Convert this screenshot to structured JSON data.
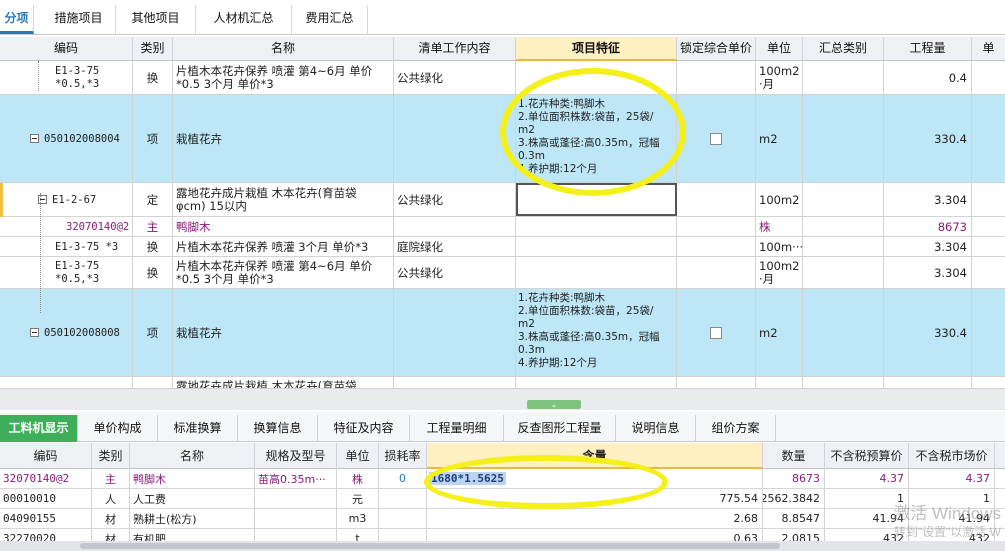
{
  "top_tabs": [
    "分项",
    "措施项目",
    "其他项目",
    "人材机汇总",
    "费用汇总"
  ],
  "grid": {
    "headers": [
      "编码",
      "类别",
      "名称",
      "清单工作内容",
      "项目特征",
      "锁定综合单价",
      "单位",
      "汇总类别",
      "工程量",
      "单"
    ],
    "rows": [
      {
        "code": "E1-3-75\n*0.5,*3",
        "type": "换",
        "name": "片植木本花卉保养 喷灌  第4~6月 单价\n*0.5  3个月 单价*3",
        "work": "公共绿化",
        "feature": "",
        "unit": "100m2\n·月",
        "qty": "0.4"
      },
      {
        "code": "050102008004",
        "type": "项",
        "name": "栽植花卉",
        "work": "",
        "feature": "1.花卉种类:鸭脚木\n2.单位面积株数:袋苗，25袋/\nm2\n3.株高或蓬径:高0.35m，冠幅\n0.3m\n4.养护期:12个月",
        "unit": "m2",
        "qty": "330.4"
      },
      {
        "code": "E1-2-67",
        "type": "定",
        "name": "露地花卉成片栽植 木本花卉(育苗袋\nφcm) 15以内",
        "work": "公共绿化",
        "feature": "",
        "unit": "100m2",
        "qty": "3.304"
      },
      {
        "code": "32070140@2",
        "type": "主",
        "name": "鸭脚木",
        "work": "",
        "feature": "",
        "unit": "株",
        "qty": "8673"
      },
      {
        "code": "E1-3-75 *3",
        "type": "换",
        "name": "片植木本花卉保养 喷灌  3个月 单价*3",
        "work": "庭院绿化",
        "feature": "",
        "unit": "100m···",
        "qty": "3.304"
      },
      {
        "code": "E1-3-75\n*0.5,*3",
        "type": "换",
        "name": "片植木本花卉保养 喷灌  第4~6月 单价\n*0.5  3个月 单价*3",
        "work": "公共绿化",
        "feature": "",
        "unit": "100m2\n·月",
        "qty": "3.304"
      },
      {
        "code": "050102008008",
        "type": "项",
        "name": "栽植花卉",
        "work": "",
        "feature": "1.花卉种类:鸭脚木\n2.单位面积株数:袋苗，25袋/\nm2\n3.株高或蓬径:高0.35m，冠幅\n0.3m\n4.养护期:12个月",
        "unit": "m2",
        "qty": "330.4"
      },
      {
        "code": "",
        "type": "",
        "name": "露地花卉成片栽植 木本花卉(育苗袋",
        "work": "",
        "feature": "",
        "unit": "",
        "qty": ""
      }
    ]
  },
  "bottom_tabs": [
    "工料机显示",
    "单价构成",
    "标准换算",
    "换算信息",
    "特征及内容",
    "工程量明细",
    "反查图形工程量",
    "说明信息",
    "组价方案"
  ],
  "bottom_grid": {
    "headers": [
      "编码",
      "类别",
      "名称",
      "规格及型号",
      "单位",
      "损耗率",
      "含量",
      "数量",
      "不含税预算价",
      "不含税市场价"
    ],
    "rows": [
      {
        "code": "32070140@2",
        "type": "主",
        "name": "鸭脚木",
        "spec": "苗高0.35m···",
        "unit": "株",
        "loss": "0",
        "content": "1680*1.5625",
        "amount": "8673",
        "budget": "4.37",
        "market": "4.37"
      },
      {
        "code": "00010010",
        "type": "人",
        "name": "人工费",
        "spec": "",
        "unit": "元",
        "loss": "",
        "content": "775.54",
        "amount": "2562.3842",
        "budget": "1",
        "market": "1"
      },
      {
        "code": "04090155",
        "type": "材",
        "name": "熟耕土(松方)",
        "spec": "",
        "unit": "m3",
        "loss": "",
        "content": "2.68",
        "amount": "8.8547",
        "budget": "41.94",
        "market": "41.94"
      },
      {
        "code": "32270020",
        "type": "材",
        "name": "有机肥",
        "spec": "",
        "unit": "t",
        "loss": "",
        "content": "0.63",
        "amount": "2.0815",
        "budget": "432",
        "market": "432"
      }
    ]
  },
  "watermark": {
    "line1": "激活 Windows",
    "line2": "转到\"设置\"以激活 W"
  },
  "colors": {
    "accent": "#2a7ab8",
    "highlight_row": "#bde6f7",
    "green_tab": "#3eae5a",
    "annotation": "#f5f01a",
    "purple": "#8a1a78"
  }
}
